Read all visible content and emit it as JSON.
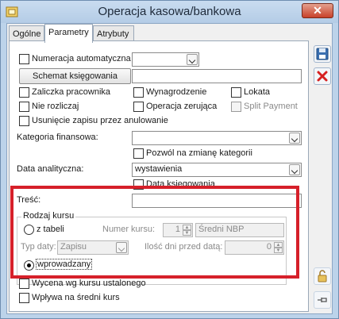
{
  "window": {
    "title": "Operacja kasowa/bankowa",
    "close_label": "✕"
  },
  "tabs": [
    {
      "label": "Ogólne"
    },
    {
      "label": "Parametry"
    },
    {
      "label": "Atrybuty"
    }
  ],
  "form": {
    "numeracja_label": "Numeracja automatyczna",
    "numeracja_value": "",
    "schemat_button": "Schemat księgowania",
    "schemat_value": "",
    "zaliczka_label": "Zaliczka pracownika",
    "wynagrodzenie_label": "Wynagrodzenie",
    "lokata_label": "Lokata",
    "nie_rozliczaj_label": "Nie rozliczaj",
    "operacja_zerujaca_label": "Operacja zerująca",
    "split_payment_label": "Split Payment",
    "usuniecie_label": "Usunięcie zapisu przez anulowanie",
    "kategoria_label": "Kategoria finansowa:",
    "kategoria_value": "",
    "pozwol_label": "Pozwól na zmianę kategorii",
    "data_analityczna_label": "Data analityczna:",
    "data_analityczna_value": "wystawienia",
    "data_ksiegowania_label": "Data księgowania",
    "tresc_label": "Treść:",
    "tresc_value": ""
  },
  "kurs": {
    "group_title": "Rodzaj kursu",
    "z_tabeli_label": "z tabeli",
    "numer_kursu_label": "Numer kursu:",
    "numer_kursu_value": "1",
    "sredni_nbp": "Średni NBP",
    "typ_daty_label": "Typ daty:",
    "typ_daty_value": "Zapisu",
    "ilosc_dni_label": "Ilość dni przed datą:",
    "ilosc_dni_value": "0",
    "wprowadzany_label": "wprowadzany"
  },
  "bottom": {
    "wycena_label": "Wycena wg kursu ustalonego",
    "wplywa_label": "Wpływa na średni kurs"
  },
  "colors": {
    "accent": "#d6202a",
    "save_icon": "#3a6fb0",
    "delete_icon": "#d62020"
  },
  "icons": [
    "app-icon",
    "save-icon",
    "delete-icon",
    "lock-icon",
    "pin-icon"
  ]
}
